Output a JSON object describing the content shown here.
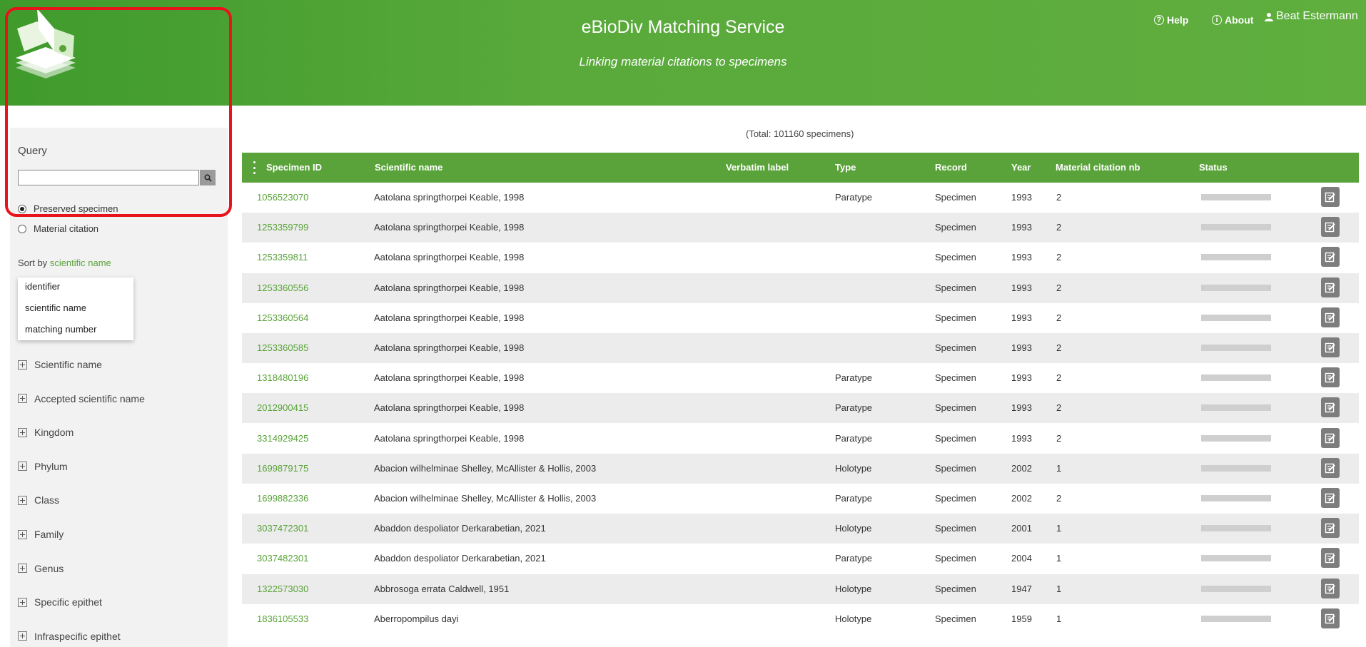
{
  "header": {
    "title": "eBioDiv Matching Service",
    "subtitle": "Linking material citations to specimens",
    "nav": {
      "help_label": "Help",
      "about_label": "About",
      "user_label": "Beat Estermann"
    }
  },
  "sidebar": {
    "query_label": "Query",
    "search": {
      "value": "",
      "placeholder": ""
    },
    "radios": [
      {
        "label": "Preserved specimen",
        "selected": true
      },
      {
        "label": "Material citation",
        "selected": false
      }
    ],
    "sort": {
      "label": "Sort by",
      "value": "scientific name",
      "options": [
        "identifier",
        "scientific name",
        "matching number"
      ]
    },
    "facets": [
      "Scientific name",
      "Accepted scientific name",
      "Kingdom",
      "Phylum",
      "Class",
      "Family",
      "Genus",
      "Specific epithet",
      "Infraspecific epithet"
    ]
  },
  "main": {
    "total_text": "(Total: 101160 specimens)",
    "columns": [
      "Specimen ID",
      "Scientific name",
      "Verbatim label",
      "Type",
      "Record",
      "Year",
      "Material citation nb",
      "Status"
    ],
    "rows": [
      {
        "id": "1056523070",
        "name": "Aatolana springthorpei Keable, 1998",
        "label": "",
        "type": "Paratype",
        "record": "Specimen",
        "year": "1993",
        "nb": "2"
      },
      {
        "id": "1253359799",
        "name": "Aatolana springthorpei Keable, 1998",
        "label": "",
        "type": "",
        "record": "Specimen",
        "year": "1993",
        "nb": "2"
      },
      {
        "id": "1253359811",
        "name": "Aatolana springthorpei Keable, 1998",
        "label": "",
        "type": "",
        "record": "Specimen",
        "year": "1993",
        "nb": "2"
      },
      {
        "id": "1253360556",
        "name": "Aatolana springthorpei Keable, 1998",
        "label": "",
        "type": "",
        "record": "Specimen",
        "year": "1993",
        "nb": "2"
      },
      {
        "id": "1253360564",
        "name": "Aatolana springthorpei Keable, 1998",
        "label": "",
        "type": "",
        "record": "Specimen",
        "year": "1993",
        "nb": "2"
      },
      {
        "id": "1253360585",
        "name": "Aatolana springthorpei Keable, 1998",
        "label": "",
        "type": "",
        "record": "Specimen",
        "year": "1993",
        "nb": "2"
      },
      {
        "id": "1318480196",
        "name": "Aatolana springthorpei Keable, 1998",
        "label": "",
        "type": "Paratype",
        "record": "Specimen",
        "year": "1993",
        "nb": "2"
      },
      {
        "id": "2012900415",
        "name": "Aatolana springthorpei Keable, 1998",
        "label": "",
        "type": "Paratype",
        "record": "Specimen",
        "year": "1993",
        "nb": "2"
      },
      {
        "id": "3314929425",
        "name": "Aatolana springthorpei Keable, 1998",
        "label": "",
        "type": "Paratype",
        "record": "Specimen",
        "year": "1993",
        "nb": "2"
      },
      {
        "id": "1699879175",
        "name": "Abacion wilhelminae Shelley, McAllister & Hollis, 2003",
        "label": "",
        "type": "Holotype",
        "record": "Specimen",
        "year": "2002",
        "nb": "1"
      },
      {
        "id": "1699882336",
        "name": "Abacion wilhelminae Shelley, McAllister & Hollis, 2003",
        "label": "",
        "type": "Paratype",
        "record": "Specimen",
        "year": "2002",
        "nb": "2"
      },
      {
        "id": "3037472301",
        "name": "Abaddon despoliator Derkarabetian, 2021",
        "label": "",
        "type": "Holotype",
        "record": "Specimen",
        "year": "2001",
        "nb": "1"
      },
      {
        "id": "3037482301",
        "name": "Abaddon despoliator Derkarabetian, 2021",
        "label": "",
        "type": "Paratype",
        "record": "Specimen",
        "year": "2004",
        "nb": "1"
      },
      {
        "id": "1322573030",
        "name": "Abbrosoga errata Caldwell, 1951",
        "label": "",
        "type": "Holotype",
        "record": "Specimen",
        "year": "1947",
        "nb": "1"
      },
      {
        "id": "1836105533",
        "name": "Aberropompilus dayi",
        "label": "",
        "type": "Holotype",
        "record": "Specimen",
        "year": "1959",
        "nb": "1"
      }
    ]
  },
  "colors": {
    "brand_green": "#5aa33a",
    "highlight_red": "#e8141b"
  },
  "icons": {
    "logo": "ebiodiv-logo",
    "search": "search-icon",
    "help": "help-icon",
    "about": "info-icon",
    "user": "user-icon",
    "column_menu": "kebab-menu-icon",
    "edit": "edit-icon",
    "facet_expand": "plus-box-icon"
  }
}
